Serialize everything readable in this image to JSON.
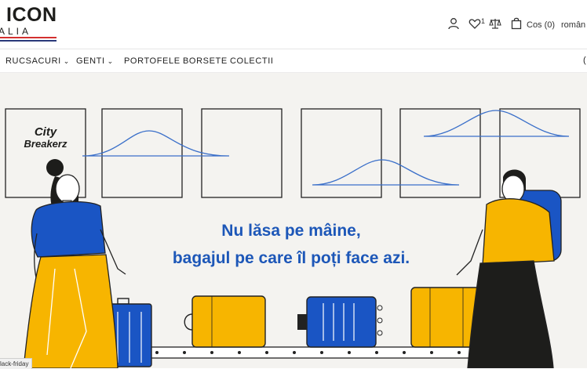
{
  "header": {
    "logo_main": "ICON",
    "logo_sub": "ALIA",
    "wishlist_count": "1",
    "cart_label": "Cos (0)",
    "language": "român"
  },
  "nav": {
    "items": [
      {
        "label": "RUCSACURI",
        "has_dropdown": true
      },
      {
        "label": "GENTI",
        "has_dropdown": true
      },
      {
        "label": "PORTOFELE",
        "has_dropdown": false
      },
      {
        "label": "BORSETE",
        "has_dropdown": false
      },
      {
        "label": "COLECTII",
        "has_dropdown": false
      }
    ],
    "edge_text": "("
  },
  "banner": {
    "brand_line1": "City",
    "brand_line2": "Breakerz",
    "headline_line1": "Nu lăsa pe mâine,",
    "headline_line2": "bagajul pe care îl poți face azi.",
    "headline_color": "#1d57b8",
    "accent_yellow": "#f7b500",
    "accent_blue": "#1a55c4"
  },
  "status_bar": {
    "text": "lack-friday"
  },
  "icons": [
    "user-icon",
    "heart-icon",
    "compare-scale-icon",
    "shopping-bag-icon",
    "chevron-down-icon"
  ]
}
